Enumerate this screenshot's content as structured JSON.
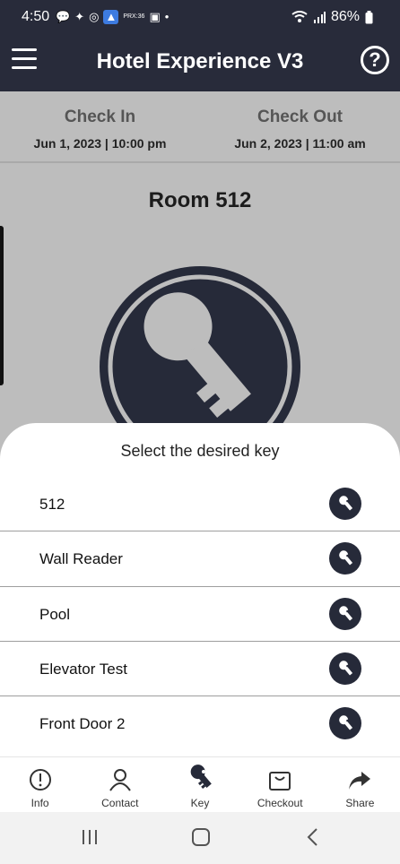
{
  "status": {
    "time": "4:50",
    "battery": "86%",
    "notif_label": "PRX:36"
  },
  "header": {
    "title": "Hotel Experience V3"
  },
  "stay": {
    "check_in_label": "Check In",
    "check_in_value": "Jun 1, 2023 | 10:00 pm",
    "check_out_label": "Check Out",
    "check_out_value": "Jun 2, 2023 | 11:00 am",
    "room": "Room 512"
  },
  "sheet": {
    "heading": "Select the desired key",
    "keys": [
      {
        "label": "512"
      },
      {
        "label": "Wall Reader"
      },
      {
        "label": "Pool"
      },
      {
        "label": "Elevator Test"
      },
      {
        "label": "Front Door 2"
      }
    ]
  },
  "tabs": [
    {
      "label": "Info",
      "icon": "alert-circle-icon"
    },
    {
      "label": "Contact",
      "icon": "person-icon"
    },
    {
      "label": "Key",
      "icon": "key-icon"
    },
    {
      "label": "Checkout",
      "icon": "bag-icon"
    },
    {
      "label": "Share",
      "icon": "share-arrow-icon"
    }
  ],
  "colors": {
    "primary": "#282b3a",
    "background": "#bdbdbd",
    "sheet": "#ffffff"
  }
}
